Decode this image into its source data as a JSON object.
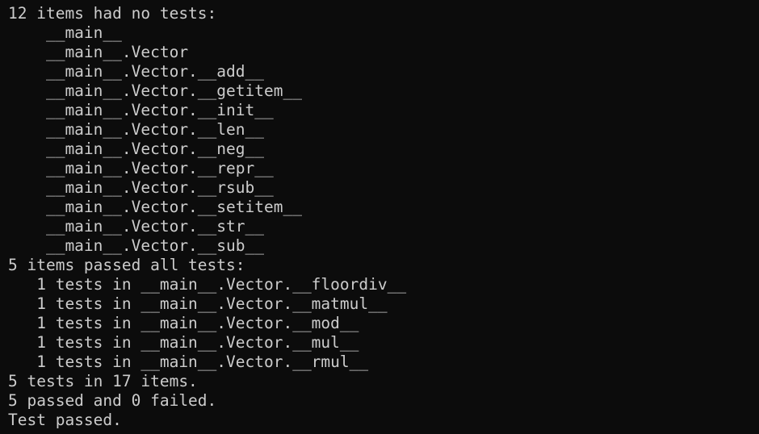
{
  "terminal": {
    "lines": [
      "12 items had no tests:",
      "    __main__",
      "    __main__.Vector",
      "    __main__.Vector.__add__",
      "    __main__.Vector.__getitem__",
      "    __main__.Vector.__init__",
      "    __main__.Vector.__len__",
      "    __main__.Vector.__neg__",
      "    __main__.Vector.__repr__",
      "    __main__.Vector.__rsub__",
      "    __main__.Vector.__setitem__",
      "    __main__.Vector.__str__",
      "    __main__.Vector.__sub__",
      "5 items passed all tests:",
      "   1 tests in __main__.Vector.__floordiv__",
      "   1 tests in __main__.Vector.__matmul__",
      "   1 tests in __main__.Vector.__mod__",
      "   1 tests in __main__.Vector.__mul__",
      "   1 tests in __main__.Vector.__rmul__",
      "5 tests in 17 items.",
      "5 passed and 0 failed.",
      "Test passed."
    ]
  },
  "colors": {
    "background": "#0c0c0c",
    "foreground": "#cccccc"
  }
}
